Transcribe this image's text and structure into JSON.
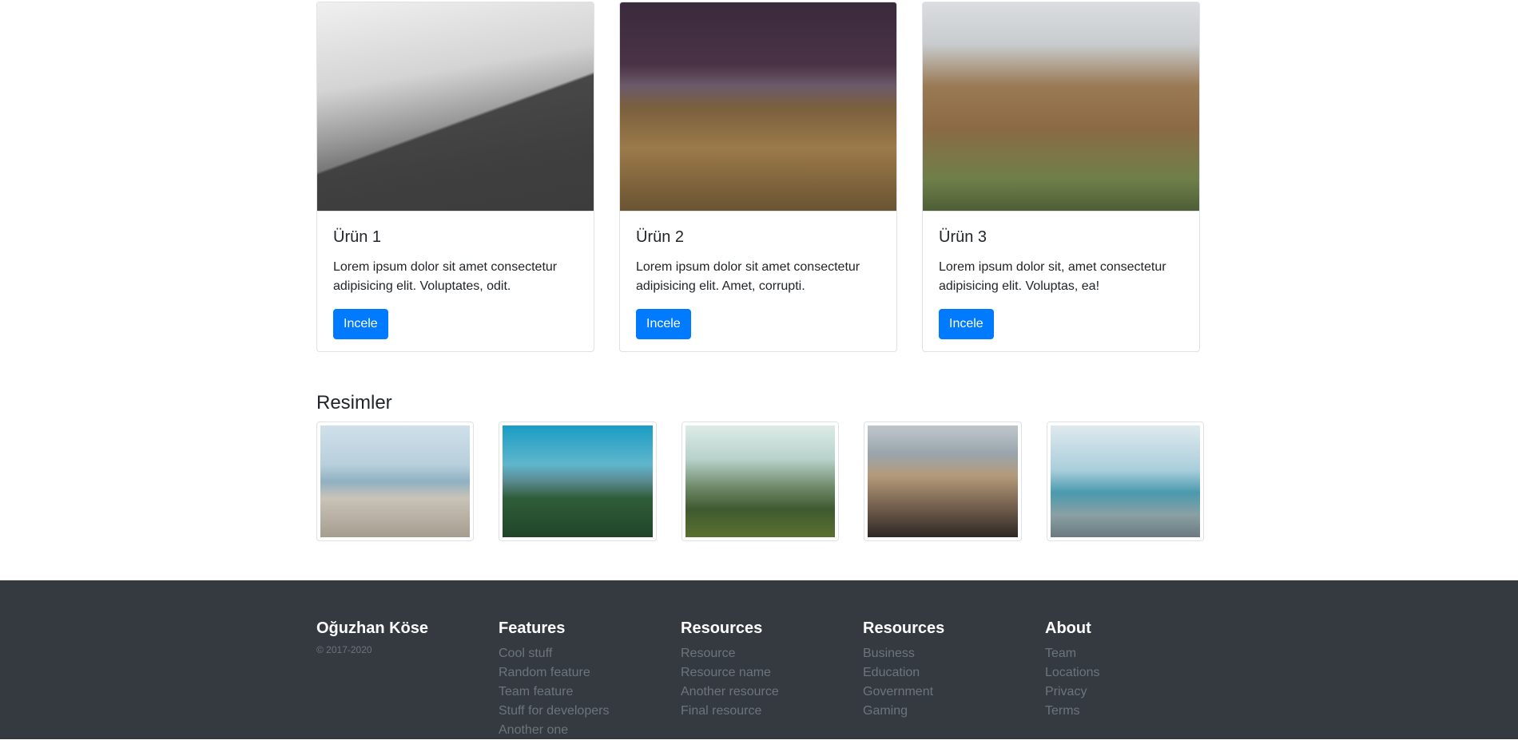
{
  "products": [
    {
      "title": "Ürün 1",
      "text": "Lorem ipsum dolor sit amet consectetur adipisicing elit. Voluptates, odit.",
      "button": "Incele",
      "image": "hills-fence-photo"
    },
    {
      "title": "Ürün 2",
      "text": "Lorem ipsum dolor sit amet consectetur adipisicing elit. Amet, corrupti.",
      "button": "Incele",
      "image": "railway-night-photo"
    },
    {
      "title": "Ürün 3",
      "text": "Lorem ipsum dolor sit, amet consectetur adipisicing elit. Voluptas, ea!",
      "button": "Incele",
      "image": "misty-forest-path-photo"
    }
  ],
  "gallery": {
    "title": "Resimler",
    "images": [
      "pelican-pier-photo",
      "sea-forest-photo",
      "valley-river-photo",
      "rocky-beach-photo",
      "pebble-shore-photo"
    ]
  },
  "footer": {
    "brand": "Oğuzhan Köse",
    "copyright": "© 2017-2020",
    "columns": [
      {
        "title": "Features",
        "links": [
          "Cool stuff",
          "Random feature",
          "Team feature",
          "Stuff for developers",
          "Another one"
        ]
      },
      {
        "title": "Resources",
        "links": [
          "Resource",
          "Resource name",
          "Another resource",
          "Final resource"
        ]
      },
      {
        "title": "Resources",
        "links": [
          "Business",
          "Education",
          "Government",
          "Gaming"
        ]
      },
      {
        "title": "About",
        "links": [
          "Team",
          "Locations",
          "Privacy",
          "Terms"
        ]
      }
    ]
  },
  "colors": {
    "primary": "#007bff",
    "footer_bg": "#343a40",
    "muted": "#6c757d"
  }
}
